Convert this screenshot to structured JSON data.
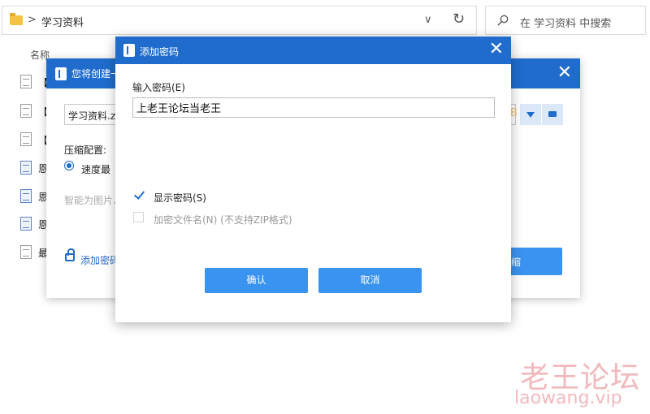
{
  "explorer": {
    "breadcrumb_sep": ">",
    "path": "学习资料",
    "dropdown_glyph": "∨",
    "refresh_glyph": "↻",
    "search_placeholder": "在 学习资料 中搜索",
    "column_name": "名称",
    "files": [
      {
        "label": "【",
        "icon": "file-icon"
      },
      {
        "label": "【",
        "icon": "file-icon"
      },
      {
        "label": "【",
        "icon": "file-icon"
      },
      {
        "label": "恩",
        "icon": "document-icon"
      },
      {
        "label": "恩",
        "icon": "document-icon"
      },
      {
        "label": "恩",
        "icon": "document-icon"
      },
      {
        "label": "最",
        "icon": "file-icon"
      }
    ]
  },
  "archive_dialog": {
    "title": "您将创建一",
    "close_glyph": "✕",
    "filename": "学习资料.zi",
    "b_glyph": "B",
    "compress_label": "压缩配置:",
    "speed_option": "速度最",
    "smart_text": "智能为图片、",
    "add_password": "添加密码",
    "action_button": "缩"
  },
  "password_dialog": {
    "title": "添加密码",
    "close_glyph": "✕",
    "input_label": "输入密码(E)",
    "password_value": "上老王论坛当老王",
    "show_password": "显示密码(S)",
    "show_password_checked": true,
    "encrypt_filename": "加密文件名(N) (不支持ZIP格式)",
    "encrypt_filename_checked": false,
    "confirm_button": "确认",
    "cancel_button": "取消"
  },
  "watermark": {
    "cn": "老王论坛",
    "en": "laowang.vip"
  },
  "colors": {
    "title_bar": "#1f6ccd",
    "button": "#3b93f0",
    "watermark": "#f2b9bd"
  }
}
